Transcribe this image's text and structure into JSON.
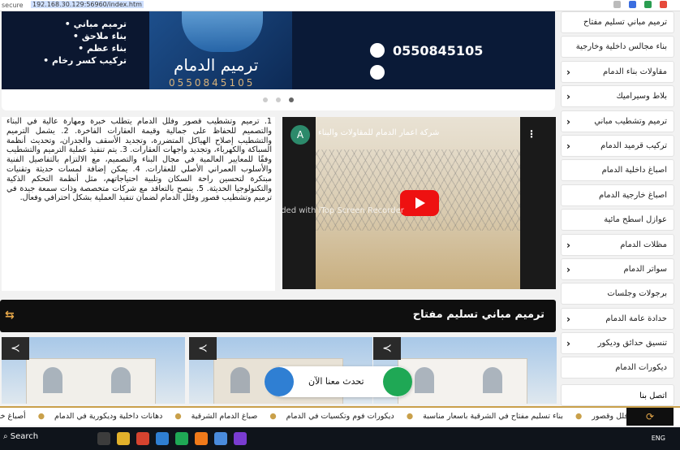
{
  "browser": {
    "secure_label": "secure",
    "url": "192.168.30.129:56960/index.htm"
  },
  "banner": {
    "services": [
      "ترميم مباني",
      "بناء ملاحق",
      "بناء عظم",
      "تركيب كسر رخام"
    ],
    "brand_title": "ترميم الدمام",
    "brand_phone": "0550845105",
    "contact_phone": "0550845105"
  },
  "article": {
    "text": "1. ترميم وتشطيب قصور وفلل الدمام يتطلب خبرة ومهارة عالية في البناء والتصميم للحفاظ على جمالية وقيمة العقارات الفاخرة. 2. يشمل الترميم والتشطيب إصلاح الهياكل المتضررة، وتجديد الأسقف والجدران، وتحديث أنظمة السباكة والكهرباء، وتجديد واجهات العقارات. 3. يتم تنفيذ عملية الترميم والتشطيب وفقًا للمعايير العالمية في مجال البناء والتصميم، مع الالتزام بالتفاصيل الفنية والأسلوب العمراني الأصلي للعقارات. 4. يمكن إضافة لمسات حديثة وتقنيات مبتكرة لتحسين راحة السكان وتلبية احتياجاتهم، مثل أنظمة التحكم الذكية والتكنولوجيا الحديثة. 5. ينصح بالتعاقد مع شركات متخصصة وذات سمعة جيدة في ترميم وتشطيب قصور وفلل الدمام لضمان تنفيذ العملية بشكل احترافي وفعال."
  },
  "video": {
    "avatar_letter": "A",
    "title": "شركة اعمار الدمام للمقاولات والبناء",
    "watermark": "Recorded with iTop Screen Recorder"
  },
  "section": {
    "title": "ترميم مباني تسليم مفتاح"
  },
  "chat": {
    "label": "تحدث معنا الآن"
  },
  "sidebar": {
    "items": [
      {
        "label": "ترميم مباني تسليم مفتاح",
        "chevron": false
      },
      {
        "label": "بناء مجالس داخلية وخارجية",
        "chevron": false
      },
      {
        "label": "مقاولات بناء الدمام",
        "chevron": true
      },
      {
        "label": "بلاط وسيراميك",
        "chevron": true
      },
      {
        "label": "ترميم وتشطيب مباني",
        "chevron": true
      },
      {
        "label": "تركيب قرميد الدمام",
        "chevron": true
      },
      {
        "label": "اصباغ داخلية الدمام",
        "chevron": false
      },
      {
        "label": "اصباغ خارجية الدمام",
        "chevron": false
      },
      {
        "label": "عوازل اسطح مائية",
        "chevron": false
      },
      {
        "label": "مظلات الدمام",
        "chevron": true
      },
      {
        "label": "سواتر الدمام",
        "chevron": true
      },
      {
        "label": "برجولات وجلسات",
        "chevron": false
      },
      {
        "label": "حدادة عامة الدمام",
        "chevron": true
      },
      {
        "label": "تنسيق حدائق وديكور",
        "chevron": true
      },
      {
        "label": "ديكورات الدمام",
        "chevron": false
      }
    ],
    "contact": "اتصل بنا"
  },
  "ticker": {
    "items": [
      "فلل وقصور",
      "بناء تسليم مفتاح في الشرقية باسعار مناسبة",
      "ديكورات فوم وتكسيات في الدمام",
      "صباغ الدمام الشرقية",
      "دهانات داخلية وديكورية في الدمام",
      "أصباغ خار"
    ]
  },
  "taskbar": {
    "search": "Search",
    "lang": "ENG"
  },
  "colors": {
    "accent": "#c9a04a",
    "dark": "#0f0f0f",
    "whatsapp": "#1fa855",
    "phone": "#2f7fd3"
  }
}
